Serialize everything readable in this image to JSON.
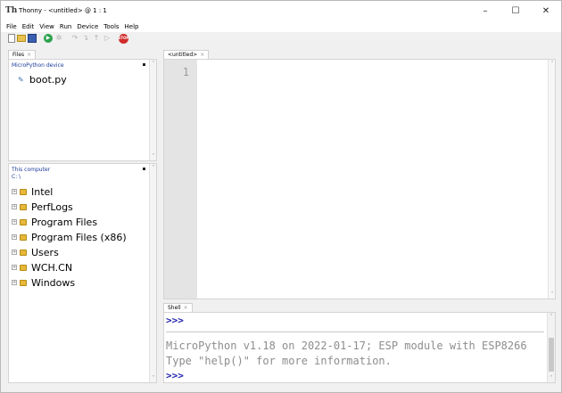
{
  "window": {
    "app_icon": "Th",
    "title": "Thonny  -  <untitled>  @  1 : 1",
    "controls": {
      "minimize": "–",
      "maximize": "☐",
      "close": "✕"
    }
  },
  "menu": [
    "File",
    "Edit",
    "View",
    "Run",
    "Device",
    "Tools",
    "Help"
  ],
  "toolbar": {
    "icons": [
      "new-file-icon",
      "open-folder-icon",
      "save-icon",
      "run-icon",
      "debug-icon",
      "step-over-icon",
      "step-into-icon",
      "step-out-icon",
      "resume-icon",
      "stop-icon"
    ],
    "stop_label": "STOP"
  },
  "files": {
    "tab_label": "Files",
    "tab_close": "×",
    "device_panel": {
      "header": "MicroPython device",
      "items": [
        {
          "name": "boot.py",
          "icon": "python-file-icon"
        }
      ]
    },
    "computer_panel": {
      "header": "This computer",
      "path": "C: \\",
      "folders": [
        "Intel",
        "PerfLogs",
        "Program Files",
        "Program Files (x86)",
        "Users",
        "WCH.CN",
        "Windows"
      ]
    }
  },
  "editor": {
    "tab_label": "<untitled>",
    "tab_close": "×",
    "line_numbers": [
      "1"
    ]
  },
  "shell": {
    "tab_label": "Shell",
    "tab_close": "×",
    "prompt": ">>>",
    "output": [
      "MicroPython v1.18 on 2022-01-17; ESP module with ESP8266",
      "Type \"help()\" for more information."
    ]
  },
  "colors": {
    "prompt": "#1d1fa8",
    "panel_header": "#1a3a9a",
    "gutter": "#e4e4e4",
    "folder": "#e5b83a"
  }
}
